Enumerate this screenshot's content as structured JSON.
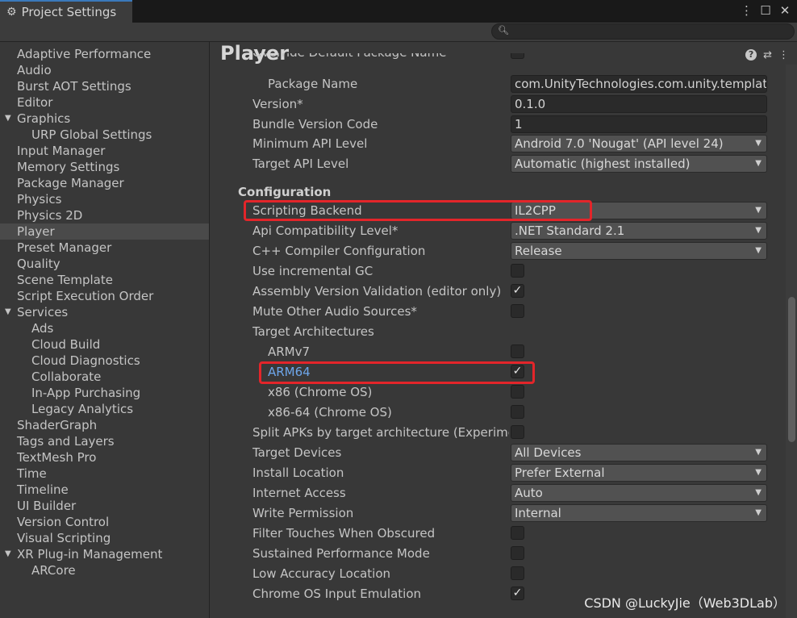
{
  "window": {
    "tab_title": "Project Settings",
    "gear_icon": "⚙",
    "controls": [
      "⋮",
      "☐",
      "✕"
    ]
  },
  "search": {
    "placeholder": "",
    "icon": "search-icon"
  },
  "sidebar": {
    "items": [
      {
        "label": "Adaptive Performance",
        "indent": 0,
        "expandable": false
      },
      {
        "label": "Audio",
        "indent": 0,
        "expandable": false
      },
      {
        "label": "Burst AOT Settings",
        "indent": 0,
        "expandable": false
      },
      {
        "label": "Editor",
        "indent": 0,
        "expandable": false
      },
      {
        "label": "Graphics",
        "indent": 0,
        "expandable": true
      },
      {
        "label": "URP Global Settings",
        "indent": 1,
        "expandable": false
      },
      {
        "label": "Input Manager",
        "indent": 0,
        "expandable": false
      },
      {
        "label": "Memory Settings",
        "indent": 0,
        "expandable": false
      },
      {
        "label": "Package Manager",
        "indent": 0,
        "expandable": false
      },
      {
        "label": "Physics",
        "indent": 0,
        "expandable": false
      },
      {
        "label": "Physics 2D",
        "indent": 0,
        "expandable": false
      },
      {
        "label": "Player",
        "indent": 0,
        "expandable": false,
        "active": true
      },
      {
        "label": "Preset Manager",
        "indent": 0,
        "expandable": false
      },
      {
        "label": "Quality",
        "indent": 0,
        "expandable": false
      },
      {
        "label": "Scene Template",
        "indent": 0,
        "expandable": false
      },
      {
        "label": "Script Execution Order",
        "indent": 0,
        "expandable": false
      },
      {
        "label": "Services",
        "indent": 0,
        "expandable": true
      },
      {
        "label": "Ads",
        "indent": 1,
        "expandable": false
      },
      {
        "label": "Cloud Build",
        "indent": 1,
        "expandable": false
      },
      {
        "label": "Cloud Diagnostics",
        "indent": 1,
        "expandable": false
      },
      {
        "label": "Collaborate",
        "indent": 1,
        "expandable": false
      },
      {
        "label": "In-App Purchasing",
        "indent": 1,
        "expandable": false
      },
      {
        "label": "Legacy Analytics",
        "indent": 1,
        "expandable": false
      },
      {
        "label": "ShaderGraph",
        "indent": 0,
        "expandable": false
      },
      {
        "label": "Tags and Layers",
        "indent": 0,
        "expandable": false
      },
      {
        "label": "TextMesh Pro",
        "indent": 0,
        "expandable": false
      },
      {
        "label": "Time",
        "indent": 0,
        "expandable": false
      },
      {
        "label": "Timeline",
        "indent": 0,
        "expandable": false
      },
      {
        "label": "UI Builder",
        "indent": 0,
        "expandable": false
      },
      {
        "label": "Version Control",
        "indent": 0,
        "expandable": false
      },
      {
        "label": "Visual Scripting",
        "indent": 0,
        "expandable": false
      },
      {
        "label": "XR Plug-in Management",
        "indent": 0,
        "expandable": true
      },
      {
        "label": "ARCore",
        "indent": 1,
        "expandable": false
      }
    ]
  },
  "main": {
    "title": "Player",
    "clipped_label": "Override Default Package Name",
    "section_configuration": "Configuration",
    "rows": [
      {
        "label": "Package Name",
        "indent": 1,
        "type": "text",
        "value": "com.UnityTechnologies.com.unity.template"
      },
      {
        "label": "Version*",
        "indent": 0,
        "type": "text",
        "value": "0.1.0"
      },
      {
        "label": "Bundle Version Code",
        "indent": 0,
        "type": "text",
        "value": "1"
      },
      {
        "label": "Minimum API Level",
        "indent": 0,
        "type": "dropdown",
        "value": "Android 7.0 'Nougat' (API level 24)"
      },
      {
        "label": "Target API Level",
        "indent": 0,
        "type": "dropdown",
        "value": "Automatic (highest installed)"
      },
      {
        "label": "Scripting Backend",
        "indent": 0,
        "type": "dropdown",
        "value": "IL2CPP"
      },
      {
        "label": "Api Compatibility Level*",
        "indent": 0,
        "type": "dropdown",
        "value": ".NET Standard 2.1"
      },
      {
        "label": "C++ Compiler Configuration",
        "indent": 0,
        "type": "dropdown",
        "value": "Release"
      },
      {
        "label": "Use incremental GC",
        "indent": 0,
        "type": "checkbox",
        "checked": false
      },
      {
        "label": "Assembly Version Validation (editor only)",
        "indent": 0,
        "type": "checkbox",
        "checked": true
      },
      {
        "label": "Mute Other Audio Sources*",
        "indent": 0,
        "type": "checkbox",
        "checked": false
      },
      {
        "label": "Target Architectures",
        "indent": 0,
        "type": "none"
      },
      {
        "label": "ARMv7",
        "indent": 1,
        "type": "checkbox",
        "checked": false
      },
      {
        "label": "ARM64",
        "indent": 1,
        "type": "checkbox",
        "checked": true,
        "highlight": true
      },
      {
        "label": "x86 (Chrome OS)",
        "indent": 1,
        "type": "checkbox",
        "checked": false
      },
      {
        "label": "x86-64 (Chrome OS)",
        "indent": 1,
        "type": "checkbox",
        "checked": false
      },
      {
        "label": "Split APKs by target architecture (Experimen",
        "indent": 0,
        "type": "checkbox",
        "checked": false
      },
      {
        "label": "Target Devices",
        "indent": 0,
        "type": "dropdown",
        "value": "All Devices"
      },
      {
        "label": "Install Location",
        "indent": 0,
        "type": "dropdown",
        "value": "Prefer External"
      },
      {
        "label": "Internet Access",
        "indent": 0,
        "type": "dropdown",
        "value": "Auto"
      },
      {
        "label": "Write Permission",
        "indent": 0,
        "type": "dropdown",
        "value": "Internal"
      },
      {
        "label": "Filter Touches When Obscured",
        "indent": 0,
        "type": "checkbox",
        "checked": false
      },
      {
        "label": "Sustained Performance Mode",
        "indent": 0,
        "type": "checkbox",
        "checked": false
      },
      {
        "label": "Low Accuracy Location",
        "indent": 0,
        "type": "checkbox",
        "checked": false
      },
      {
        "label": "Chrome OS Input Emulation",
        "indent": 0,
        "type": "checkbox",
        "checked": true
      }
    ]
  },
  "watermark": "CSDN @LuckyJie（Web3DLab）",
  "colors": {
    "highlight_border": "#e3252a",
    "selected_text": "#6ea6ea",
    "background": "#383838"
  }
}
